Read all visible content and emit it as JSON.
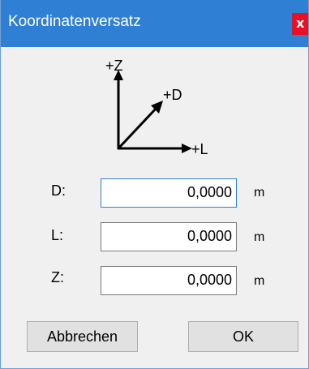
{
  "window": {
    "title": "Koordinatenversatz",
    "close_label": "x"
  },
  "diagram": {
    "z_axis": "+Z",
    "d_axis": "+D",
    "l_axis": "+L"
  },
  "fields": [
    {
      "label": "D:",
      "value": "0,0000",
      "unit": "m"
    },
    {
      "label": "L:",
      "value": "0,0000",
      "unit": "m"
    },
    {
      "label": "Z:",
      "value": "0,0000",
      "unit": "m"
    }
  ],
  "buttons": {
    "cancel": "Abbrechen",
    "ok": "OK"
  },
  "colors": {
    "titlebar": "#2f7fd5",
    "close": "#e81123",
    "focus_border": "#2f7fd5"
  }
}
